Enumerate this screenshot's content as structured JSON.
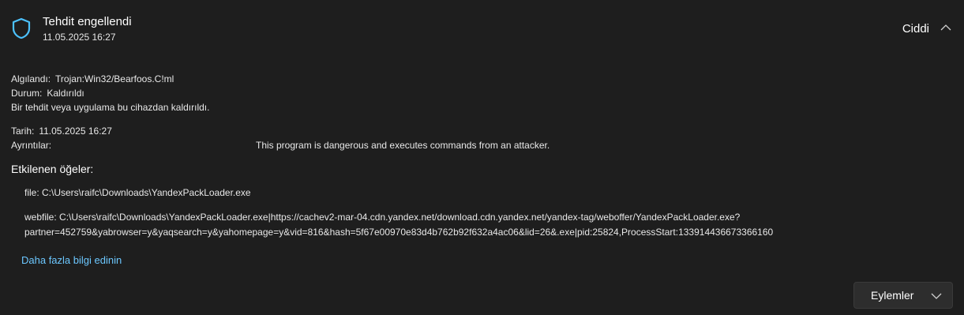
{
  "header": {
    "title": "Tehdit engellendi",
    "datetime": "11.05.2025 16:27",
    "severity": "Ciddi",
    "shield_icon": "shield-icon",
    "accent_color": "#4cc2ff"
  },
  "details": {
    "detected_label": "Algılandı:",
    "detected_value": "Trojan:Win32/Bearfoos.C!ml",
    "status_label": "Durum:",
    "status_value": "Kaldırıldı",
    "status_note": "Bir tehdit veya uygulama bu cihazdan kaldırıldı.",
    "date_label": "Tarih:",
    "date_value": "11.05.2025 16:27",
    "details_label": "Ayrıntılar:",
    "details_value": "This program is dangerous and executes commands from an attacker."
  },
  "affected": {
    "title": "Etkilenen öğeler:",
    "file_item": "file: C:\\Users\\raifc\\Downloads\\YandexPackLoader.exe",
    "webfile_line1": "webfile: C:\\Users\\raifc\\Downloads\\YandexPackLoader.exe|https://cachev2-mar-04.cdn.yandex.net/download.cdn.yandex.net/yandex-tag/weboffer/YandexPackLoader.exe?",
    "webfile_line2": "partner=452759&yabrowser=y&yaqsearch=y&yahomepage=y&vid=816&hash=5f67e00970e83d4b762b92f632a4ac06&lid=26&.exe|pid:25824,ProcessStart:133914436673366160"
  },
  "link": {
    "label": "Daha fazla bilgi edinin",
    "color": "#6cc7ff"
  },
  "actions": {
    "label": "Eylemler"
  }
}
